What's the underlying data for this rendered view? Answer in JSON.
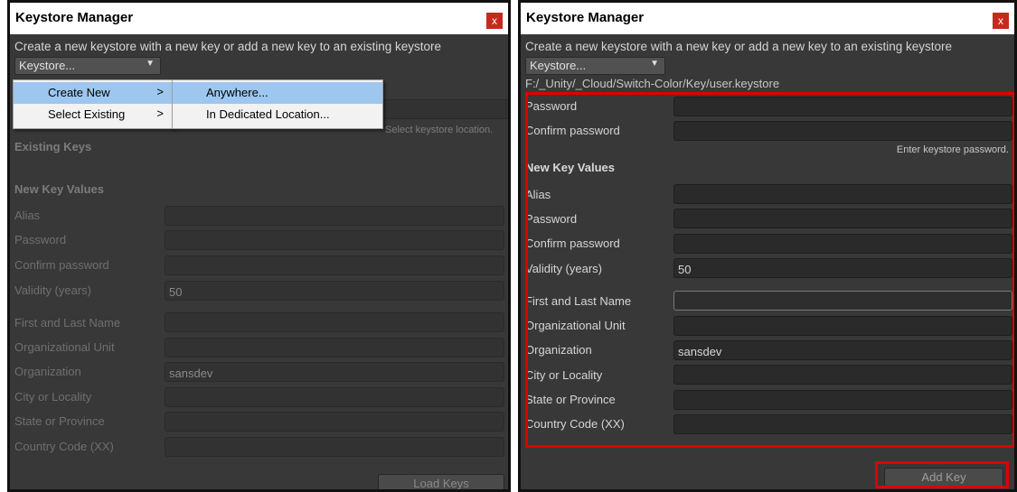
{
  "left": {
    "title": "Keystore Manager",
    "close": "x",
    "header": "Create a new keystore with a new key or add a new key to an existing keystore",
    "keystore_dropdown": "Keystore...",
    "path_hint_partial": "Select keystore location.",
    "existing_keys": "Existing Keys",
    "new_key_values": "New Key Values",
    "alias": "Alias",
    "password": "Password",
    "confirm_password": "Confirm password",
    "validity": "Validity (years)",
    "validity_value": "50",
    "first_last": "First and Last Name",
    "org_unit": "Organizational Unit",
    "organization": "Organization",
    "organization_value": "sansdev",
    "city": "City or Locality",
    "state": "State or Province",
    "country": "Country Code (XX)",
    "load_keys": "Load Keys",
    "menu": {
      "create_new": "Create New",
      "select_existing": "Select Existing",
      "arrow": ">",
      "anywhere": "Anywhere...",
      "dedicated": "In Dedicated Location..."
    }
  },
  "right": {
    "title": "Keystore Manager",
    "close": "x",
    "header": "Create a new keystore with a new key or add a new key to an existing keystore",
    "keystore_dropdown": "Keystore...",
    "path": "F:/_Unity/_Cloud/Switch-Color/Key/user.keystore",
    "password": "Password",
    "confirm_password": "Confirm password",
    "enter_password_hint": "Enter keystore password.",
    "new_key_values": "New Key Values",
    "alias": "Alias",
    "key_password": "Password",
    "key_confirm_password": "Confirm password",
    "validity": "Validity (years)",
    "validity_value": "50",
    "first_last": "First and Last Name",
    "org_unit": "Organizational Unit",
    "organization": "Organization",
    "organization_value": "sansdev",
    "city": "City or Locality",
    "state": "State or Province",
    "country": "Country Code (XX)",
    "add_key": "Add Key"
  },
  "colors": {
    "panel_bg": "#383838",
    "highlight": "#e00000",
    "menu_selected": "#9dc7ef",
    "close_button": "#c42b1c"
  }
}
